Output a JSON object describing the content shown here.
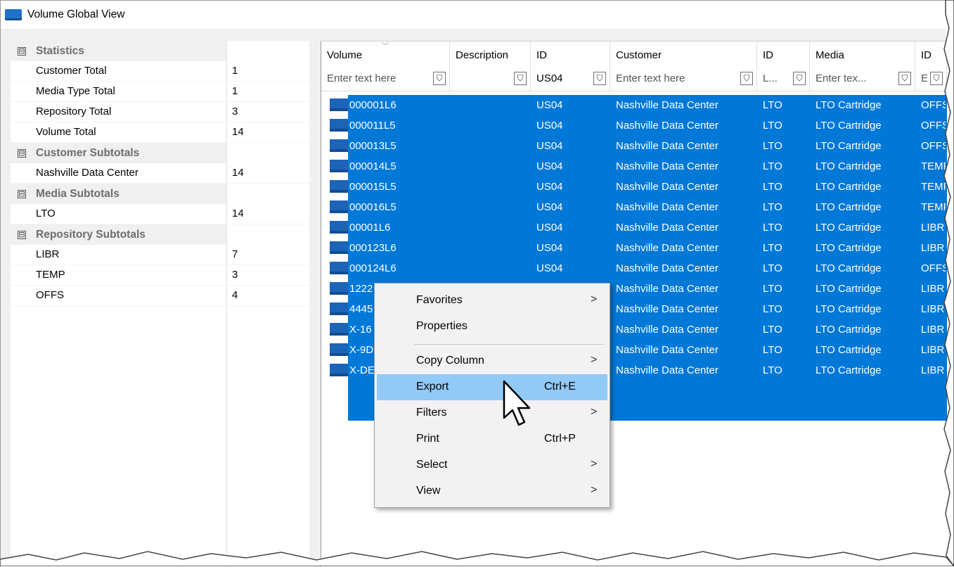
{
  "window": {
    "title": "Volume Global View"
  },
  "propgrid": {
    "categories": [
      {
        "name": "Statistics",
        "items": [
          {
            "name": "Customer Total",
            "value": "1"
          },
          {
            "name": "Media Type Total",
            "value": "1"
          },
          {
            "name": "Repository Total",
            "value": "3"
          },
          {
            "name": "Volume Total",
            "value": "14"
          }
        ]
      },
      {
        "name": "Customer Subtotals",
        "items": [
          {
            "name": "Nashville Data Center",
            "value": "14"
          }
        ]
      },
      {
        "name": "Media Subtotals",
        "items": [
          {
            "name": "LTO",
            "value": "14"
          }
        ]
      },
      {
        "name": "Repository Subtotals",
        "items": [
          {
            "name": "LIBR",
            "value": "7"
          },
          {
            "name": "TEMP",
            "value": "3"
          },
          {
            "name": "OFFS",
            "value": "4"
          }
        ]
      }
    ],
    "expander_glyph": "⊟"
  },
  "grid": {
    "columns": [
      "Volume",
      "Description",
      "ID",
      "Customer",
      "ID",
      "Media",
      "ID"
    ],
    "filters": [
      "Enter text here",
      "",
      "US04",
      "Enter text here",
      "L...",
      "Enter tex...",
      "E."
    ],
    "rows": [
      [
        "000001L6",
        "",
        "US04",
        "Nashville Data Center",
        "LTO",
        "LTO Cartridge",
        "OFFS"
      ],
      [
        "000011L5",
        "",
        "US04",
        "Nashville Data Center",
        "LTO",
        "LTO Cartridge",
        "OFFS"
      ],
      [
        "000013L5",
        "",
        "US04",
        "Nashville Data Center",
        "LTO",
        "LTO Cartridge",
        "OFFS"
      ],
      [
        "000014L5",
        "",
        "US04",
        "Nashville Data Center",
        "LTO",
        "LTO Cartridge",
        "TEMP"
      ],
      [
        "000015L5",
        "",
        "US04",
        "Nashville Data Center",
        "LTO",
        "LTO Cartridge",
        "TEMP"
      ],
      [
        "000016L5",
        "",
        "US04",
        "Nashville Data Center",
        "LTO",
        "LTO Cartridge",
        "TEMP"
      ],
      [
        "00001L6",
        "",
        "US04",
        "Nashville Data Center",
        "LTO",
        "LTO Cartridge",
        "LIBR"
      ],
      [
        "000123L6",
        "",
        "US04",
        "Nashville Data Center",
        "LTO",
        "LTO Cartridge",
        "LIBR"
      ],
      [
        "000124L6",
        "",
        "US04",
        "Nashville Data Center",
        "LTO",
        "LTO Cartridge",
        "OFFS"
      ],
      [
        "1222",
        "",
        "",
        "Nashville Data Center",
        "LTO",
        "LTO Cartridge",
        "LIBR"
      ],
      [
        "4445",
        "",
        "",
        "Nashville Data Center",
        "LTO",
        "LTO Cartridge",
        "LIBR"
      ],
      [
        "X-16",
        "",
        "",
        "Nashville Data Center",
        "LTO",
        "LTO Cartridge",
        "LIBR"
      ],
      [
        "X-9D",
        "",
        "",
        "Nashville Data Center",
        "LTO",
        "LTO Cartridge",
        "LIBR"
      ],
      [
        "X-DE",
        "",
        "",
        "Nashville Data Center",
        "LTO",
        "LTO Cartridge",
        "LIBR"
      ]
    ],
    "sort_glyph": "﹀",
    "funnel_glyph": "⛉"
  },
  "context_menu": {
    "items": [
      {
        "label": "Favorites",
        "shortcut": "",
        "submenu": true
      },
      {
        "label": "Properties",
        "shortcut": "",
        "submenu": false
      },
      {
        "label": "Copy Column",
        "shortcut": "",
        "submenu": true
      },
      {
        "label": "Export",
        "shortcut": "Ctrl+E",
        "submenu": false,
        "highlighted": true
      },
      {
        "label": "Filters",
        "shortcut": "",
        "submenu": true
      },
      {
        "label": "Print",
        "shortcut": "Ctrl+P",
        "submenu": false
      },
      {
        "label": "Select",
        "shortcut": "",
        "submenu": true
      },
      {
        "label": "View",
        "shortcut": "",
        "submenu": true
      }
    ],
    "arrow_glyph": ">"
  },
  "colors": {
    "selection": "#0078d7",
    "menu_highlight": "#91c9f7",
    "category_text": "#6d6d6d"
  }
}
